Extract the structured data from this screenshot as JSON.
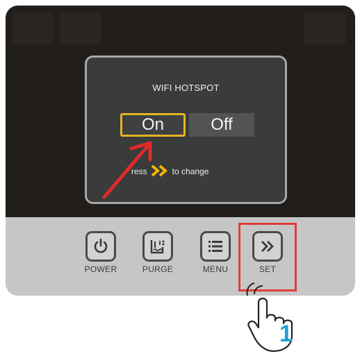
{
  "screen": {
    "title": "WIFI HOTSPOT",
    "options": [
      {
        "label": "On",
        "selected": true
      },
      {
        "label": "Off",
        "selected": false
      }
    ],
    "hint_prefix": "ress",
    "hint_icon": "double-chevron-right-icon",
    "hint_suffix": "to change"
  },
  "buttons": [
    {
      "label": "POWER",
      "icon": "power-icon"
    },
    {
      "label": "PURGE",
      "icon": "purge-icon"
    },
    {
      "label": "MENU",
      "icon": "menu-icon"
    },
    {
      "label": "SET",
      "icon": "double-chevron-right-icon",
      "highlighted": true
    }
  ],
  "annotation": {
    "step_number": "1",
    "highlight_color": "#e23b3b",
    "arrow_color": "#e02a2a",
    "selection_color": "#e6b422",
    "step_color": "#1aa0d6"
  }
}
